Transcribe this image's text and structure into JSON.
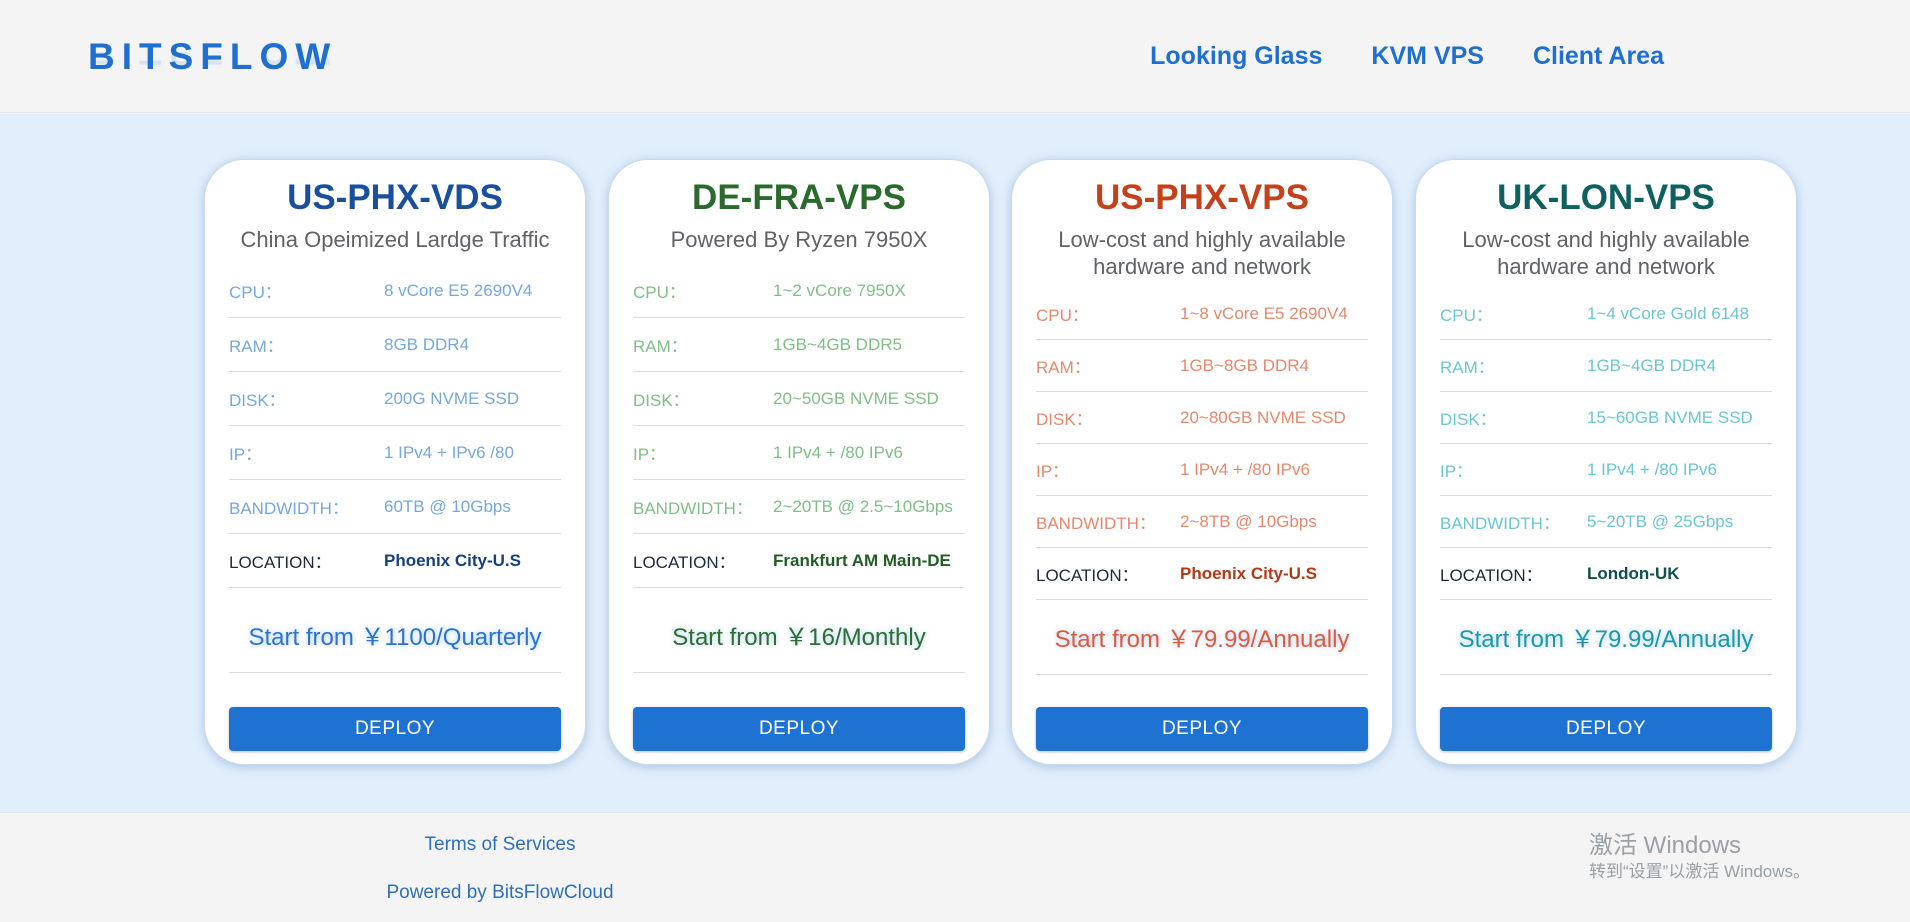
{
  "header": {
    "logo": "BITSFLOW",
    "nav": [
      "Looking Glass",
      "KVM VPS",
      "Client Area"
    ]
  },
  "plans": [
    {
      "title": "US-PHX-VDS",
      "subtitle": "China Opeimized Lardge Traffic",
      "specs": [
        {
          "label": "CPU：",
          "value": "8 vCore E5 2690V4"
        },
        {
          "label": "RAM：",
          "value": "8GB DDR4"
        },
        {
          "label": "DISK：",
          "value": "200G NVME SSD"
        },
        {
          "label": "IP：",
          "value": "1 IPv4 + IPv6 /80"
        },
        {
          "label": "BANDWIDTH：",
          "value": "60TB @ 10Gbps"
        },
        {
          "label": "LOCATION：",
          "value": "Phoenix City-U.S"
        }
      ],
      "price": "Start from ￥1100/Quarterly",
      "button": "DEPLOY",
      "colors": {
        "title": "#1a4f9e",
        "spec": "#76a8dd",
        "location": "#17407e",
        "price": "#2b73d1"
      }
    },
    {
      "title": "DE-FRA-VPS",
      "subtitle": "Powered By Ryzen 7950X",
      "specs": [
        {
          "label": "CPU：",
          "value": "1~2 vCore 7950X"
        },
        {
          "label": "RAM：",
          "value": "1GB~4GB DDR5"
        },
        {
          "label": "DISK：",
          "value": "20~50GB NVME SSD"
        },
        {
          "label": "IP：",
          "value": "1 IPv4 + /80 IPv6"
        },
        {
          "label": "BANDWIDTH：",
          "value": "2~20TB @ 2.5~10Gbps"
        },
        {
          "label": "LOCATION：",
          "value": "Frankfurt AM Main-DE"
        }
      ],
      "price": "Start from ￥16/Monthly",
      "button": "DEPLOY",
      "colors": {
        "title": "#2a6a2d",
        "spec": "#7fbf86",
        "location": "#235c25",
        "price": "#2c6f31"
      }
    },
    {
      "title": "US-PHX-VPS",
      "subtitle": "Low-cost and highly available hardware and network",
      "specs": [
        {
          "label": "CPU：",
          "value": "1~8 vCore E5 2690V4"
        },
        {
          "label": "RAM：",
          "value": "1GB~8GB DDR4"
        },
        {
          "label": "DISK：",
          "value": "20~80GB NVME SSD"
        },
        {
          "label": "IP：",
          "value": "1 IPv4 + /80 IPv6"
        },
        {
          "label": "BANDWIDTH：",
          "value": "2~8TB @ 10Gbps"
        },
        {
          "label": "LOCATION：",
          "value": "Phoenix City-U.S"
        }
      ],
      "price": "Start from ￥79.99/Annually",
      "button": "DEPLOY",
      "colors": {
        "title": "#c4411b",
        "spec": "#e7886b",
        "location": "#b23a16",
        "price": "#e05a3b"
      }
    },
    {
      "title": "UK-LON-VPS",
      "subtitle": "Low-cost and highly available hardware and network",
      "specs": [
        {
          "label": "CPU：",
          "value": "1~4 vCore Gold 6148"
        },
        {
          "label": "RAM：",
          "value": "1GB~4GB DDR4"
        },
        {
          "label": "DISK：",
          "value": "15~60GB NVME SSD"
        },
        {
          "label": "IP：",
          "value": "1 IPv4 + /80 IPv6"
        },
        {
          "label": "BANDWIDTH：",
          "value": "5~20TB @ 25Gbps"
        },
        {
          "label": "LOCATION：",
          "value": "London-UK"
        }
      ],
      "price": "Start from ￥79.99/Annually",
      "button": "DEPLOY",
      "colors": {
        "title": "#0f6160",
        "spec": "#69c6d2",
        "location": "#0f4f4c",
        "price": "#1a9aa8"
      }
    }
  ],
  "footer": {
    "terms": "Terms of Services",
    "powered": "Powered by BitsFlowCloud"
  },
  "watermark": {
    "line1": "激活 Windows",
    "line2": "转到“设置”以激活 Windows。"
  }
}
